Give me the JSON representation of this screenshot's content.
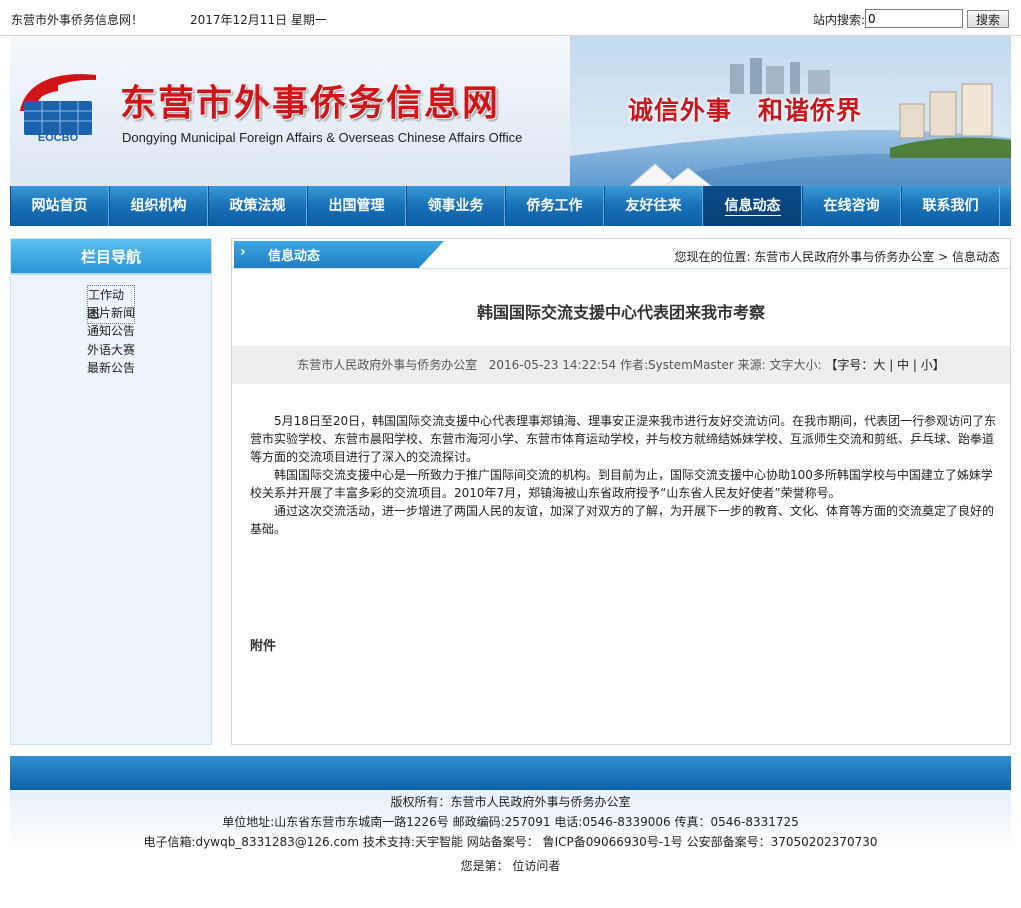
{
  "topbar": {
    "site_name": "东营市外事侨务信息网！",
    "date": "2017年12月11日 星期一",
    "search_label": "站内搜索:",
    "search_value": "0",
    "search_button": "搜索"
  },
  "banner": {
    "title": "东营市外事侨务信息网",
    "subtitle": "Dongying Municipal Foreign Affairs & Overseas Chinese Affairs Office",
    "logo_text": "EOCBO",
    "slogan": "诚信外事　和谐侨界",
    "logo_icon": "eocbo-logo-icon"
  },
  "nav": {
    "items": [
      {
        "label": "网站首页"
      },
      {
        "label": "组织机构"
      },
      {
        "label": "政策法规"
      },
      {
        "label": "出国管理"
      },
      {
        "label": "领事业务"
      },
      {
        "label": "侨务工作"
      },
      {
        "label": "友好往来"
      },
      {
        "label": "信息动态",
        "active": true
      },
      {
        "label": "在线咨询"
      },
      {
        "label": "联系我们"
      }
    ]
  },
  "sidebar": {
    "title": "栏目导航",
    "items": [
      {
        "label": "工作动态"
      },
      {
        "label": "图片新闻"
      },
      {
        "label": "通知公告"
      },
      {
        "label": "外语大赛"
      },
      {
        "label": "最新公告"
      }
    ]
  },
  "main": {
    "tab_label": "信息动态",
    "breadcrumb": "您现在的位置: 东营市人民政府外事与侨务办公室 > 信息动态",
    "article_title": "韩国国际交流支援中心代表团来我市考察",
    "meta": {
      "source": "东营市人民政府外事与侨务办公室",
      "datetime": "2016-05-23 14:22:54",
      "author": "作者:SystemMaster",
      "origin": "来源:",
      "font_size_label": "文字大小:",
      "font_size_options": "【字号：大 | 中 | 小】"
    },
    "paragraphs": [
      "5月18日至20日，韩国国际交流支援中心代表理事郑镇海、理事安正湜来我市进行友好交流访问。在我市期间，代表团一行参观访问了东营市实验学校、东营市晨阳学校、东营市海河小学、东营市体育运动学校，并与校方就缔结姊妹学校、互派师生交流和剪纸、乒乓球、跆拳道等方面的交流项目进行了深入的交流探讨。",
      "韩国国际交流支援中心是一所致力于推广国际间交流的机构。到目前为止，国际交流支援中心协助100多所韩国学校与中国建立了姊妹学校关系并开展了丰富多彩的交流项目。2010年7月，郑镇海被山东省政府授予“山东省人民友好使者”荣誉称号。",
      "通过这次交流活动，进一步增进了两国人民的友谊，加深了对双方的了解，为开展下一步的教育、文化、体育等方面的交流奠定了良好的基础。"
    ],
    "attachment_label": "附件"
  },
  "footer": {
    "copyright": "版权所有：东营市人民政府外事与侨务办公室",
    "address": "单位地址:山东省东营市东城南一路1226号  邮政编码:257091  电话:0546-8339006  传真：0546-8331725",
    "contact": "电子信箱:dywqb_8331283@126.com    技术支持:天宇智能  网站备案号： 鲁ICP备09066930号-1号   公安部备案号：37050202370730",
    "visitor": "您是第：  位访问者"
  },
  "colors": {
    "brand_red": "#d01418",
    "nav_blue": "#1870b6",
    "sidebar_bg": "#edf4fb"
  }
}
